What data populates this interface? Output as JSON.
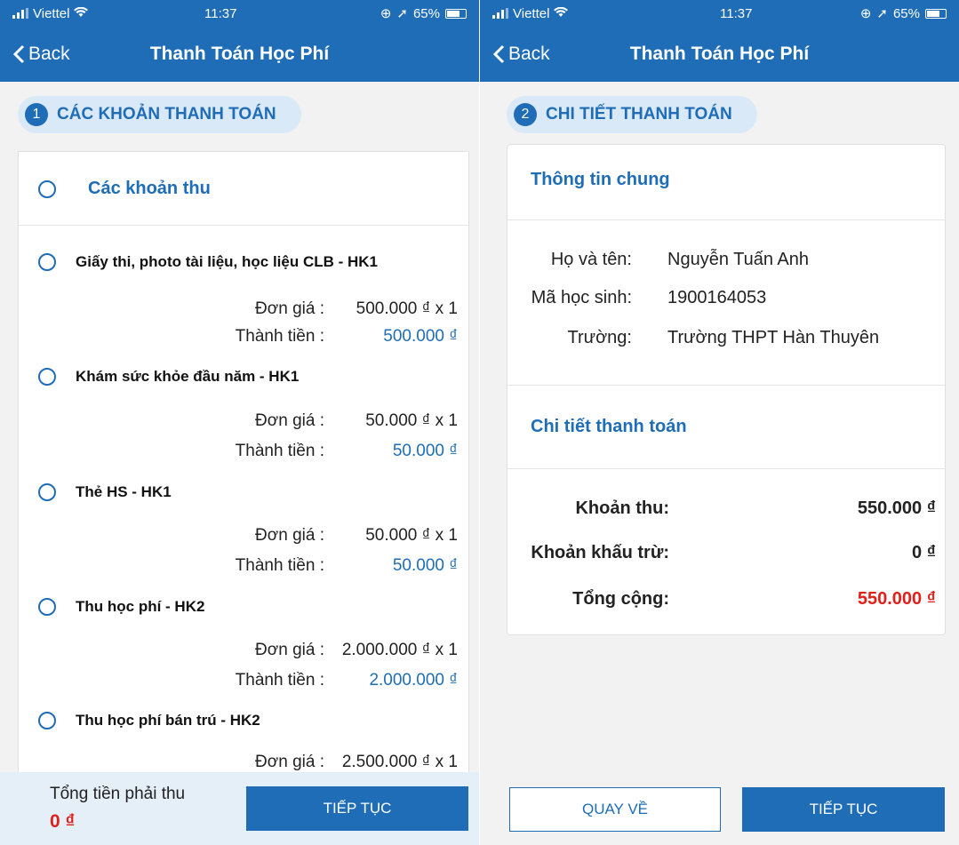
{
  "status": {
    "carrier": "Viettel",
    "time": "11:37",
    "battery": "65%"
  },
  "nav": {
    "back_label": "Back",
    "title": "Thanh Toán Học Phí"
  },
  "left": {
    "step_number": "1",
    "step_title": "CÁC KHOẢN THANH TOÁN",
    "group_label": "Các khoản thu",
    "items": [
      {
        "name": "Giấy thi, photo tài liệu, học liệu CLB  - HK1",
        "unit_label": "Đơn giá :",
        "unit_price": "500.000 ₫ x 1",
        "total_label": "Thành tiền :",
        "total": "500.000 ₫"
      },
      {
        "name": "Khám sức khỏe đầu năm  - HK1",
        "unit_label": "Đơn giá :",
        "unit_price": "50.000 ₫ x 1",
        "total_label": "Thành tiền :",
        "total": "50.000 ₫"
      },
      {
        "name": "Thẻ HS  - HK1",
        "unit_label": "Đơn giá :",
        "unit_price": "50.000 ₫ x 1",
        "total_label": "Thành tiền :",
        "total": "50.000 ₫"
      },
      {
        "name": "Thu học phí  - HK2",
        "unit_label": "Đơn giá :",
        "unit_price": "2.000.000 ₫ x 1",
        "total_label": "Thành tiền :",
        "total": "2.000.000 ₫"
      },
      {
        "name": "Thu học phí bán trú  - HK2",
        "unit_label": "Đơn giá :",
        "unit_price": "2.500.000 ₫ x 1"
      }
    ],
    "footer_label": "Tổng tiền phải thu",
    "footer_total": "0 ₫",
    "continue_label": "TIẾP TỤC"
  },
  "right": {
    "step_number": "2",
    "step_title": "CHI TIẾT THANH TOÁN",
    "general_heading": "Thông tin chung",
    "name_label": "Họ và tên:",
    "name_value": "Nguyễn Tuấn Anh",
    "id_label": "Mã học sinh:",
    "id_value": "1900164053",
    "school_label": "Trường:",
    "school_value": "Trường THPT  Hàn Thuyên",
    "detail_heading": "Chi tiết thanh toán",
    "receivable_label": "Khoản thu:",
    "receivable_value": "550.000 ₫",
    "deduction_label": "Khoản khấu trừ:",
    "deduction_value": "0 ₫",
    "total_label": "Tổng cộng:",
    "total_value": "550.000 ₫",
    "back_button_label": "QUAY VỀ",
    "continue_label": "TIẾP TỤC"
  },
  "colors": {
    "primary": "#1e6db6",
    "accent_red": "#e0201b",
    "step_bg": "#d9e9f7"
  }
}
